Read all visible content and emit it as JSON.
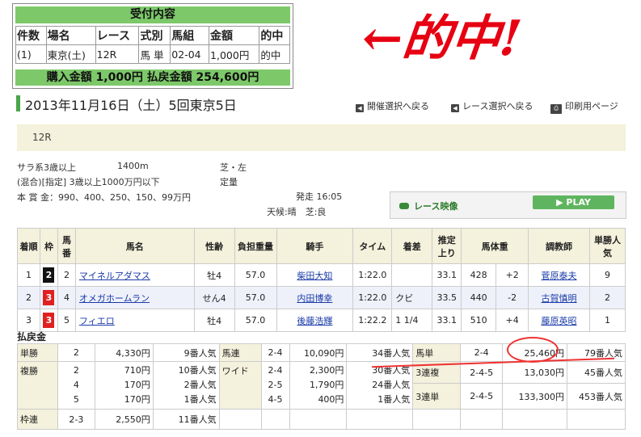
{
  "receipt": {
    "title": "受付内容",
    "headers": [
      "件数",
      "場名",
      "レース",
      "式別",
      "馬組",
      "金額",
      "的中"
    ],
    "row": [
      "(1)",
      "東京(土)",
      "12R",
      "馬 単",
      "02-04",
      "1,000円",
      "的中"
    ],
    "footer": "購入金額 1,000円 払戻金額 254,600円"
  },
  "annotation": "←的中!",
  "page_title": "2013年11月16日（土）5回東京5日",
  "nav": {
    "back_meeting": "開催選択へ戻る",
    "back_race": "レース選択へ戻る",
    "print": "印刷用ページ"
  },
  "race": {
    "number": "12R",
    "class": "サラ系3歳以上",
    "distance": "1400m",
    "surface": "芝・左",
    "condition": "(混合)[指定] 3歳以上1000万円以下",
    "weight_rule": "定量",
    "prize": "本 賞 金：990、400、250、150、99万円",
    "start_time": "発走 16:05",
    "weather": "天候:晴　芝:良"
  },
  "video": {
    "label": "レース映像",
    "play": "PLAY"
  },
  "results": {
    "headers": [
      "着順",
      "枠",
      "馬番",
      "馬名",
      "性齢",
      "負担重量",
      "騎手",
      "タイム",
      "着差",
      "推定上り",
      "馬体重",
      "",
      "調教師",
      "単勝人気"
    ],
    "rows": [
      {
        "pos": "1",
        "waku": "2",
        "waku_color": "#111111",
        "num": "2",
        "horse": "マイネルアダマス",
        "sex_age": "牡4",
        "weight": "57.0",
        "jockey": "柴田大知",
        "time": "1:22.0",
        "margin": "",
        "last3f": "33.1",
        "body": "428",
        "diff": "+2",
        "trainer": "菅原泰夫",
        "pop": "9"
      },
      {
        "pos": "2",
        "waku": "3",
        "waku_color": "#e02020",
        "num": "4",
        "horse": "オメガホームラン",
        "sex_age": "せん4",
        "weight": "57.0",
        "jockey": "内田博幸",
        "time": "1:22.0",
        "margin": "クビ",
        "last3f": "33.5",
        "body": "440",
        "diff": "-2",
        "trainer": "古賀慎明",
        "pop": "2"
      },
      {
        "pos": "3",
        "waku": "3",
        "waku_color": "#e02020",
        "num": "5",
        "horse": "フィエロ",
        "sex_age": "牡4",
        "weight": "57.0",
        "jockey": "後藤浩輝",
        "time": "1:22.2",
        "margin": "1 1/4",
        "last3f": "33.1",
        "body": "510",
        "diff": "+4",
        "trainer": "藤原英昭",
        "pop": "1"
      }
    ]
  },
  "payout": {
    "title": "払戻金",
    "tansho": {
      "label": "単勝",
      "combo": "2",
      "amount": "4,330円",
      "pop": "9番人気"
    },
    "umaren": {
      "label": "馬連",
      "combo": "2-4",
      "amount": "10,090円",
      "pop": "34番人気"
    },
    "umatan": {
      "label": "馬単",
      "combo": "2-4",
      "amount": "25,460円",
      "pop": "79番人気"
    },
    "fukusho": {
      "label": "複勝",
      "combos": "2\n4\n5",
      "amounts": "710円\n170円\n170円",
      "pops": "10番人気\n2番人気\n1番人気"
    },
    "wide": {
      "label": "ワイド",
      "combos": "2-4\n2-5\n4-5",
      "amounts": "2,300円\n1,790円\n400円",
      "pops": "30番人気\n24番人気\n1番人気"
    },
    "sanrenpuku": {
      "label": "3連複",
      "combo": "2-4-5",
      "amount": "13,030円",
      "pop": "45番人気"
    },
    "sanrentan": {
      "label": "3連単",
      "combo": "2-4-5",
      "amount": "133,300円",
      "pop": "453番人気"
    },
    "wakuren": {
      "label": "枠連",
      "combo": "2-3",
      "amount": "2,550円",
      "pop": "11番人気"
    }
  },
  "colors": {
    "accent_green": "#7dc96a",
    "highlight_red": "#e33333",
    "band": "#f4f1dc",
    "link": "#1a3aa8"
  }
}
